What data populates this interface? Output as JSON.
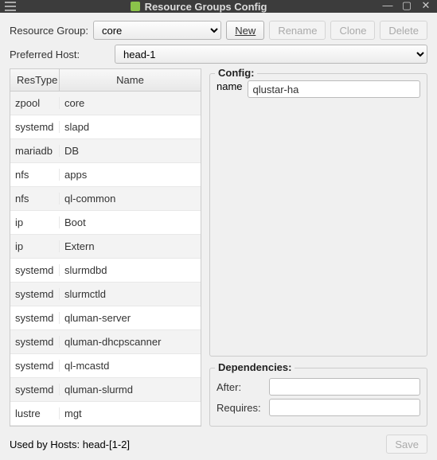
{
  "window": {
    "title": "Resource Groups Config"
  },
  "labels": {
    "resource_group": "Resource Group:",
    "preferred_host": "Preferred Host:",
    "config": "Config:",
    "dependencies": "Dependencies:",
    "after": "After:",
    "requires": "Requires:",
    "name": "name"
  },
  "buttons": {
    "new": "New",
    "rename": "Rename",
    "clone": "Clone",
    "delete": "Delete",
    "save": "Save"
  },
  "resource_group_selected": "core",
  "preferred_host_selected": "head-1",
  "table": {
    "headers": {
      "restype": "ResType",
      "name": "Name"
    },
    "rows": [
      {
        "type": "zpool",
        "name": "core"
      },
      {
        "type": "systemd",
        "name": "slapd"
      },
      {
        "type": "mariadb",
        "name": "DB"
      },
      {
        "type": "nfs",
        "name": "apps"
      },
      {
        "type": "nfs",
        "name": "ql-common"
      },
      {
        "type": "ip",
        "name": "Boot"
      },
      {
        "type": "ip",
        "name": "Extern"
      },
      {
        "type": "systemd",
        "name": "slurmdbd"
      },
      {
        "type": "systemd",
        "name": "slurmctld"
      },
      {
        "type": "systemd",
        "name": "qluman-server"
      },
      {
        "type": "systemd",
        "name": "qluman-dhcpscanner"
      },
      {
        "type": "systemd",
        "name": "ql-mcastd"
      },
      {
        "type": "systemd",
        "name": "qluman-slurmd"
      },
      {
        "type": "lustre",
        "name": "mgt"
      }
    ]
  },
  "config": {
    "name_value": "qlustar-ha"
  },
  "dependencies": {
    "after": "",
    "requires": ""
  },
  "footer": {
    "used_by": "Used by Hosts: head-[1-2]"
  }
}
